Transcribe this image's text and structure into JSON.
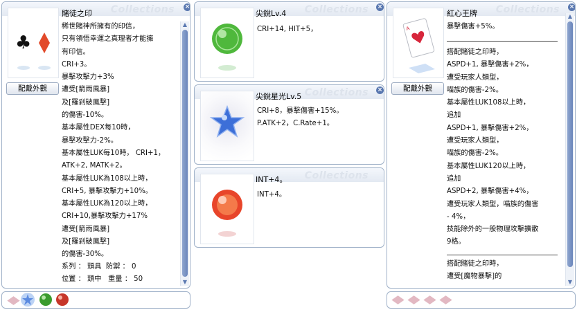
{
  "watermark": "Collections",
  "left_item": {
    "name": "賭徒之印",
    "button": "配戴外觀",
    "lines": [
      "稀世賭神所擁有的印信，",
      "只有領悟幸運之真理者才能擁",
      "有印信。",
      "CRI+3。",
      "暴擊攻擊力+3%",
      "遭受[箭雨風暴]",
      "及[羅剎破鳳擊]",
      "的傷害-10%。",
      "基本屬性DEX每10時，",
      "暴擊攻擊力-2%。",
      "基本屬性LUK每10時， CRI+1，",
      "ATK+2, MATK+2。",
      "基本屬性LUK為108以上時，",
      "CRI+5, 暴擊攻擊力+10%。",
      "基本屬性LUK為120以上時，",
      "CRI+10,暴擊攻擊力+17%",
      "遭受[箭雨風暴]",
      "及[羅剎破鳳擊]",
      "的傷害-30%。"
    ],
    "type_label": "系列 ： 頭具",
    "def_label": "防禦 ： 0",
    "pos_label": "位置 ： 頭中",
    "weight_label": "重量 ： 50"
  },
  "mid_items": [
    {
      "name": "尖銳Lv.4",
      "lines": [
        "CRI+14, HIT+5，"
      ],
      "orb_color": "#4fb83c"
    },
    {
      "name": "尖銳星光Lv.5",
      "lines": [
        "CRI+8，暴擊傷害+15%。",
        "P.ATK+2，C.Rate+1。"
      ],
      "orb_color": "#3d6fd8"
    },
    {
      "name": "INT+4。",
      "lines": [
        "INT+4。"
      ],
      "orb_color": "#e8452a"
    }
  ],
  "right_item": {
    "name": "紅心王牌",
    "button": "配戴外觀",
    "lines_top": [
      "暴擊傷害+5%。"
    ],
    "lines_mid": [
      "搭配賭徒之印時，",
      "ASPD+1, 暴擊傷害+2%，",
      "遭受玩家人類型，",
      "喵族的傷害-2%。",
      "基本屬性LUK108以上時，",
      "追加",
      "ASPD+1, 暴擊傷害+2%，",
      "遭受玩家人類型，",
      "喵族的傷害-2%。",
      "基本屬性LUK120以上時，",
      "追加",
      "ASPD+2, 暴擊傷害+4%，",
      "遭受玩家人類型，喵族的傷害",
      "- 4%，",
      "技能除外的一般物理攻擊擴散",
      "9格。"
    ],
    "lines_bottom": [
      "搭配賭徒之印時，",
      "遭受[魔物暴擊]的"
    ]
  },
  "close_glyph": "⊗"
}
